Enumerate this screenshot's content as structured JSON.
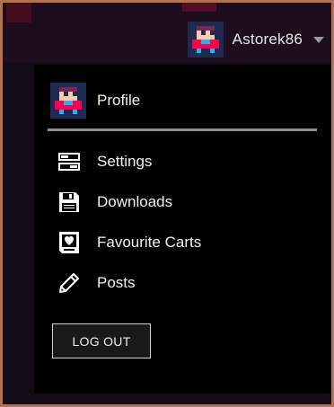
{
  "header": {
    "username": "Astorek86",
    "dropdown_icon": "chevron-down-icon"
  },
  "menu": {
    "profile_label": "Profile",
    "items": [
      {
        "label": "Settings",
        "icon": "settings-icon"
      },
      {
        "label": "Downloads",
        "icon": "floppy-disk-icon"
      },
      {
        "label": "Favourite Carts",
        "icon": "heart-cart-icon"
      },
      {
        "label": "Posts",
        "icon": "pencil-icon"
      }
    ],
    "logout_label": "LOG OUT"
  },
  "colors": {
    "page_frame": "#b3714f",
    "topbar": "#1d0d1d",
    "menu_bg": "#000000",
    "avatar_bg": "#1d2b53",
    "avatar_skin": "#ffccaa",
    "avatar_shirt": "#ff004d",
    "avatar_hair": "#7e2553"
  }
}
